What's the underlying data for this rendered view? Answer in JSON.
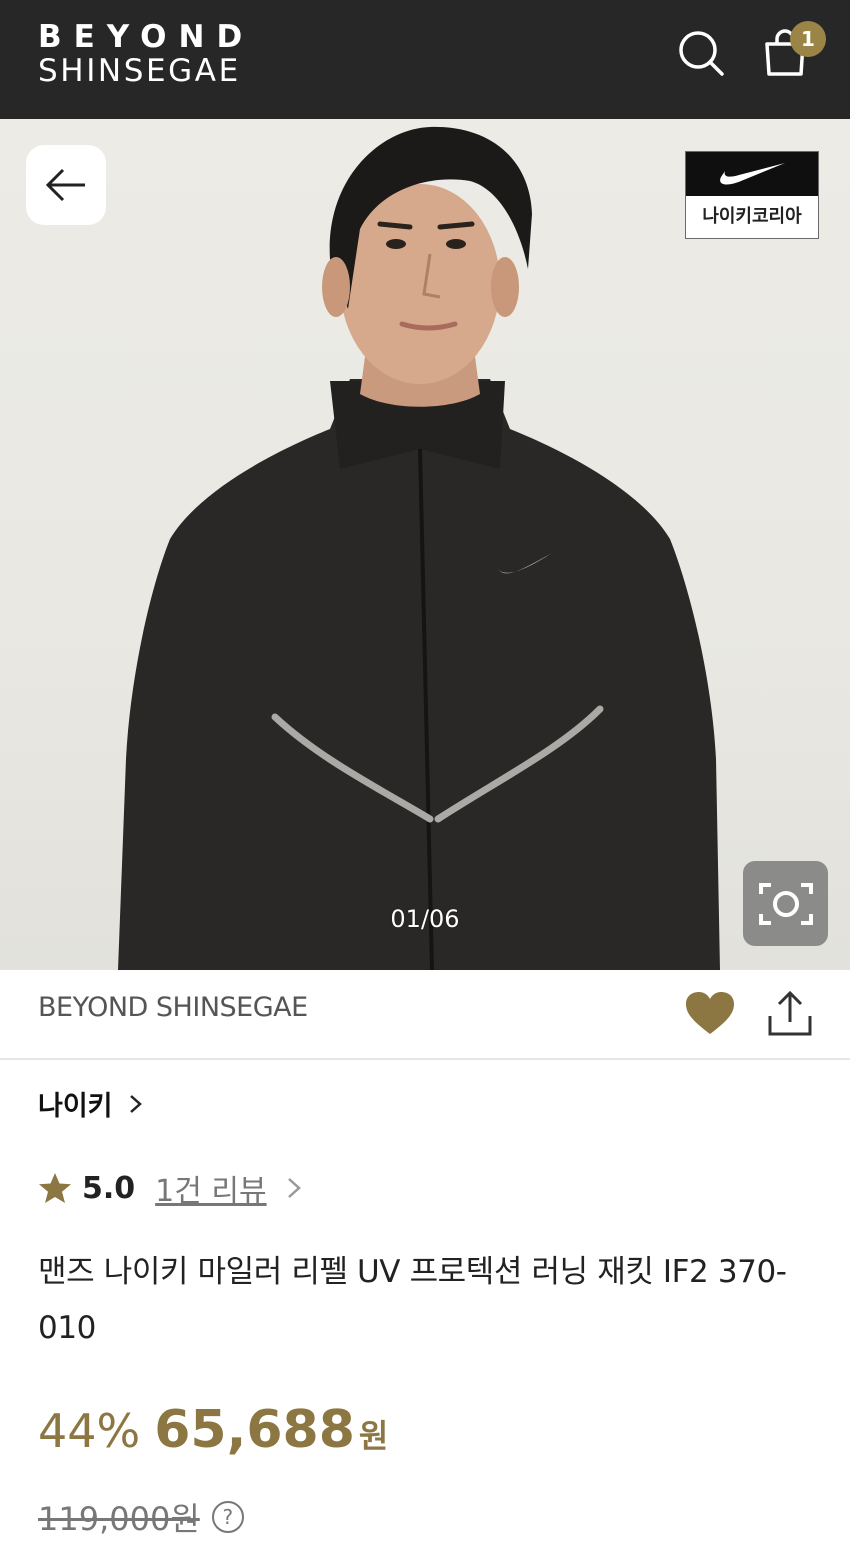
{
  "header": {
    "logo_line1": "BEYOND",
    "logo_line2": "SHINSEGAE",
    "search_icon": "search-icon",
    "cart_icon": "shopping-bag-icon",
    "cart_count": "1",
    "bg_color": "#272727",
    "accent_color": "#9a8547"
  },
  "gallery": {
    "back_icon": "arrow-left-icon",
    "brand_badge_label": "나이키코리아",
    "brand_badge_icon": "nike-swoosh-icon",
    "counter": "01/06",
    "lens_icon": "camera-lens-icon"
  },
  "store": {
    "name": "BEYOND SHINSEGAE",
    "wish_icon": "heart-icon",
    "share_icon": "share-icon"
  },
  "product": {
    "brand": "나이키",
    "rating_icon": "star-icon",
    "rating": "5.0",
    "reviews": "1건 리뷰",
    "title": "맨즈 나이키 마일러 리펠 UV 프로텍션 러닝 재킷 IF2 370-010",
    "discount": "44%",
    "price": "65,688",
    "currency": "원",
    "original_price": "119,000원",
    "info_icon": "question-circle-icon",
    "price_color": "#8c7641"
  }
}
